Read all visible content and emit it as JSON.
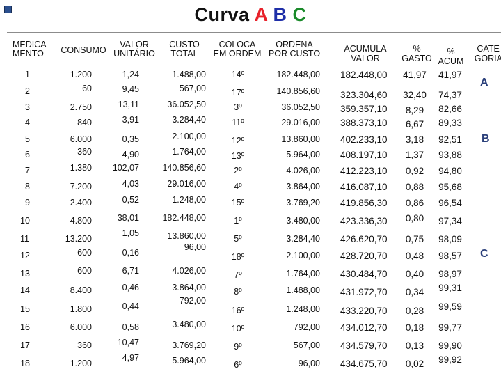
{
  "title": {
    "prefix": "Curva",
    "a": "A",
    "b": "B",
    "c": "C"
  },
  "headers": {
    "medicamento": "MEDICA-\nMENTO",
    "consumo": "CONSUMO",
    "valor_unitario": "VALOR\nUNITÁRIO",
    "custo_total": "CUSTO\nTOTAL",
    "coloca_ordem": "COLOCA\nEM ORDEM",
    "ordena_custo": "ORDENA\nPOR CUSTO",
    "acumula_valor": "ACUMULA\nVALOR",
    "pct_gasto": "%\nGASTO",
    "pct_acum": "%\nACUM",
    "categoria": "CATE-\nGORIA"
  },
  "rows": [
    {
      "med": "1",
      "consumo": "1.200",
      "unit": "1,24",
      "total": "1.488,00",
      "ordem": "14º",
      "ordena": "182.448,00",
      "acum": "182.448,00",
      "gasto": "41,97",
      "pacum": "41,97"
    },
    {
      "med": "2",
      "consumo": "60",
      "unit": "9,45",
      "total": "567,00",
      "ordem": "17º",
      "ordena": "140.856,60",
      "acum": "323.304,60",
      "gasto": "32,40",
      "pacum": "74,37"
    },
    {
      "med": "3",
      "consumo": "2.750",
      "unit": "13,11",
      "total": "36.052,50",
      "ordem": "3º",
      "ordena": "36.052,50",
      "acum": "359.357,10",
      "gasto": "8,29",
      "pacum": "82,66"
    },
    {
      "med": "4",
      "consumo": "840",
      "unit": "3,91",
      "total": "3.284,40",
      "ordem": "11º",
      "ordena": "29.016,00",
      "acum": "388.373,10",
      "gasto": "6,67",
      "pacum": "89,33"
    },
    {
      "med": "5",
      "consumo": "6.000",
      "unit": "0,35",
      "total": "2.100,00",
      "ordem": "12º",
      "ordena": "13.860,00",
      "acum": "402.233,10",
      "gasto": "3,18",
      "pacum": "92,51"
    },
    {
      "med": "6",
      "consumo": "360",
      "unit": "4,90",
      "total": "1.764,00",
      "ordem": "13º",
      "ordena": "5.964,00",
      "acum": "408.197,10",
      "gasto": "1,37",
      "pacum": "93,88"
    },
    {
      "med": "7",
      "consumo": "1.380",
      "unit": "102,07",
      "total": "140.856,60",
      "ordem": "2º",
      "ordena": "4.026,00",
      "acum": "412.223,10",
      "gasto": "0,92",
      "pacum": "94,80"
    },
    {
      "med": "8",
      "consumo": "7.200",
      "unit": "4,03",
      "total": "29.016,00",
      "ordem": "4º",
      "ordena": "3.864,00",
      "acum": "416.087,10",
      "gasto": "0,88",
      "pacum": "95,68"
    },
    {
      "med": "9",
      "consumo": "2.400",
      "unit": "0,52",
      "total": "1.248,00",
      "ordem": "15º",
      "ordena": "3.769,20",
      "acum": "419.856,30",
      "gasto": "0,86",
      "pacum": "96,54"
    },
    {
      "med": "10",
      "consumo": "4.800",
      "unit": "38,01",
      "total": "182.448,00",
      "ordem": "1º",
      "ordena": "3.480,00",
      "acum": "423.336,30",
      "gasto": "0,80",
      "pacum": "97,34"
    },
    {
      "med": "11",
      "consumo": "13.200",
      "unit": "1,05",
      "total": "13.860,00",
      "ordem": "5º",
      "ordena": "3.284,40",
      "acum": "426.620,70",
      "gasto": "0,75",
      "pacum": "98,09"
    },
    {
      "med": "12",
      "consumo": "600",
      "unit": "0,16",
      "total": "96,00",
      "ordem": "18º",
      "ordena": "2.100,00",
      "acum": "428.720,70",
      "gasto": "0,48",
      "pacum": "98,57"
    },
    {
      "med": "13",
      "consumo": "600",
      "unit": "6,71",
      "total": "4.026,00",
      "ordem": "7º",
      "ordena": "1.764,00",
      "acum": "430.484,70",
      "gasto": "0,40",
      "pacum": "98,97"
    },
    {
      "med": "14",
      "consumo": "8.400",
      "unit": "0,46",
      "total": "3.864,00",
      "ordem": "8º",
      "ordena": "1.488,00",
      "acum": "431.972,70",
      "gasto": "0,34",
      "pacum": "99,31"
    },
    {
      "med": "15",
      "consumo": "1.800",
      "unit": "0,44",
      "total": "792,00",
      "ordem": "16º",
      "ordena": "1.248,00",
      "acum": "433.220,70",
      "gasto": "0,28",
      "pacum": "99,59"
    },
    {
      "med": "16",
      "consumo": "6.000",
      "unit": "0,58",
      "total": "3.480,00",
      "ordem": "10º",
      "ordena": "792,00",
      "acum": "434.012,70",
      "gasto": "0,18",
      "pacum": "99,77"
    },
    {
      "med": "17",
      "consumo": "360",
      "unit": "10,47",
      "total": "3.769,20",
      "ordem": "9º",
      "ordena": "567,00",
      "acum": "434.579,70",
      "gasto": "0,13",
      "pacum": "99,90"
    },
    {
      "med": "18",
      "consumo": "1.200",
      "unit": "4,97",
      "total": "5.964,00",
      "ordem": "6º",
      "ordena": "96,00",
      "acum": "434.675,70",
      "gasto": "0,02",
      "pacum": "99,92"
    }
  ],
  "categories": [
    {
      "label": "A"
    },
    {
      "label": "B"
    },
    {
      "label": "C"
    }
  ],
  "colors": {
    "a": "#e8212a",
    "b": "#1f2fa8",
    "c": "#1a8a2a",
    "category": "#2a3f7a",
    "bullet": "#2b4f8e"
  }
}
